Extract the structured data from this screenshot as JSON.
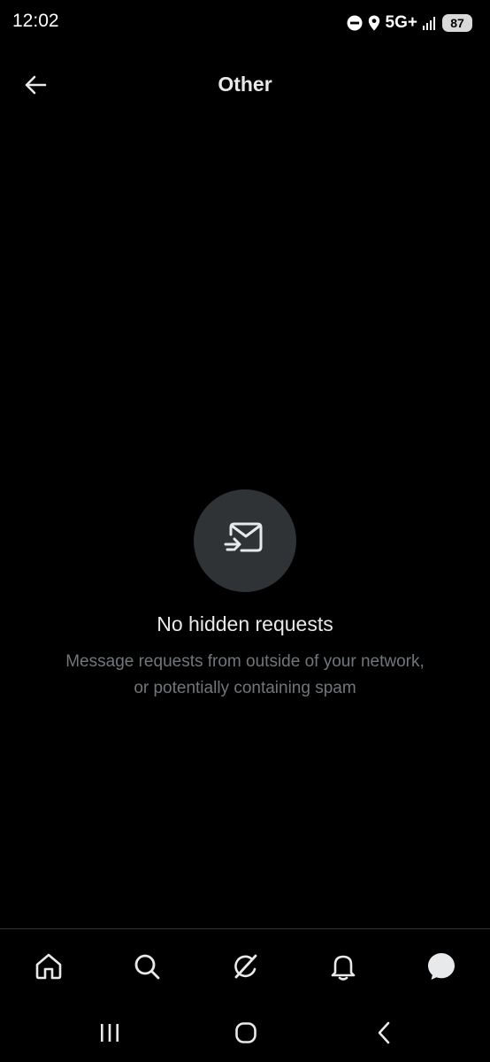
{
  "status_bar": {
    "time": "12:02",
    "network": "5G+",
    "battery": "87"
  },
  "header": {
    "title": "Other"
  },
  "empty_state": {
    "icon": "message-request-icon",
    "title": "No hidden requests",
    "subtitle_line1": "Message requests from outside of your network,",
    "subtitle_line2": "or potentially containing spam"
  },
  "tabs": [
    {
      "icon": "home-icon"
    },
    {
      "icon": "search-icon"
    },
    {
      "icon": "grok-icon"
    },
    {
      "icon": "bell-icon"
    },
    {
      "icon": "messages-icon",
      "active": true
    }
  ],
  "system_nav": [
    "recents-icon",
    "home-circle-icon",
    "back-chevron-icon"
  ],
  "colors": {
    "background": "#000000",
    "primary_text": "#e7e9ea",
    "secondary_text": "#71767b",
    "icon_circle": "#2f3336"
  }
}
